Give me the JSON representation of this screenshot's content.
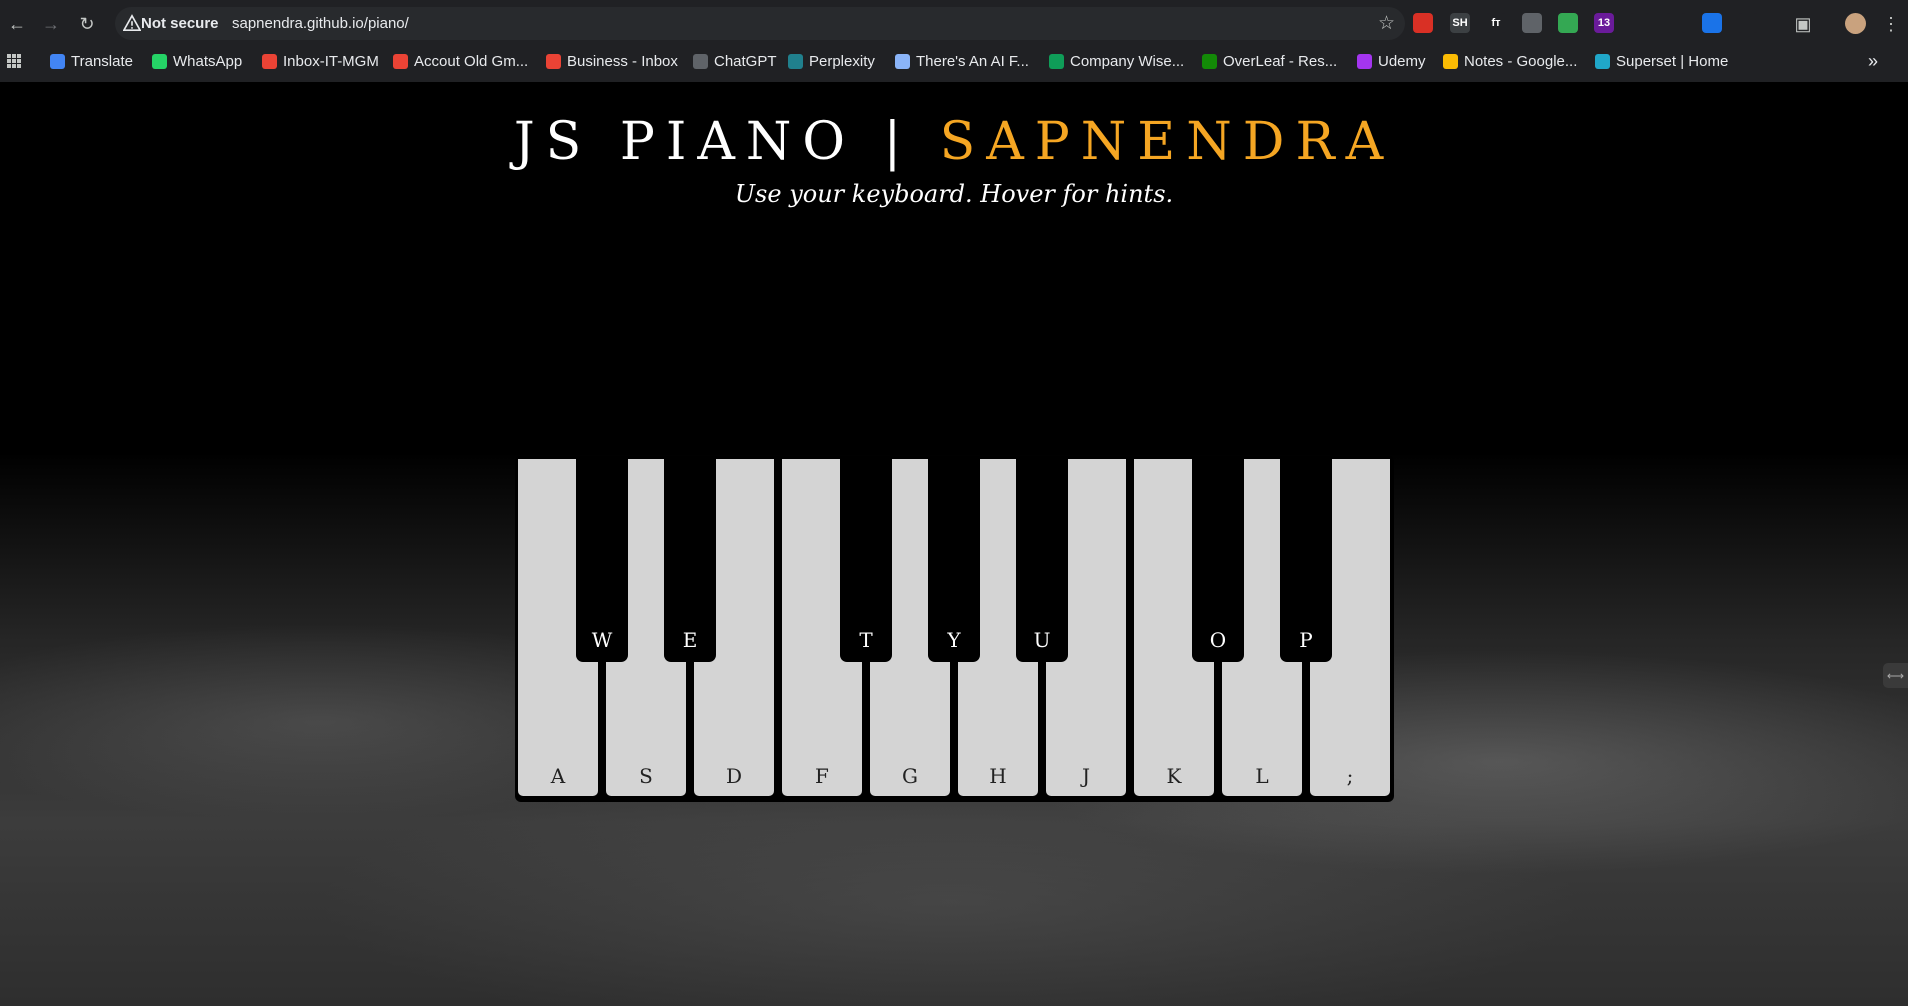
{
  "browser": {
    "security_label": "Not secure",
    "url": "sapnendra.github.io/piano/",
    "extensions": [
      {
        "icon": "pdf-icon",
        "color": "#d93025",
        "text": ""
      },
      {
        "icon": "sh-icon",
        "color": "#3c4043",
        "text": "SH"
      },
      {
        "icon": "function-icon",
        "color": "#202124",
        "text": "fт"
      },
      {
        "icon": "camera-icon",
        "color": "#5f6368",
        "text": ""
      },
      {
        "icon": "shield-icon",
        "color": "#34a853",
        "text": ""
      },
      {
        "icon": "badge-icon",
        "color": "#6a1b9a",
        "text": "13"
      },
      {
        "icon": "eyedropper-icon",
        "color": "#202124",
        "text": ""
      },
      {
        "icon": "atom-icon",
        "color": "#202124",
        "text": ""
      },
      {
        "icon": "bot-icon",
        "color": "#1a73e8",
        "text": ""
      },
      {
        "icon": "puzzle-icon",
        "color": "#202124",
        "text": ""
      }
    ],
    "bookmarks": [
      {
        "label": "Translate",
        "icon": "translate-icon",
        "color": "#4285f4"
      },
      {
        "label": "WhatsApp",
        "icon": "whatsapp-icon",
        "color": "#25d366"
      },
      {
        "label": "Inbox-IT-MGM",
        "icon": "gmail-icon",
        "color": "#ea4335"
      },
      {
        "label": "Accout Old Gm...",
        "icon": "gmail-icon",
        "color": "#ea4335"
      },
      {
        "label": "Business - Inbox",
        "icon": "gmail-icon",
        "color": "#ea4335"
      },
      {
        "label": "ChatGPT",
        "icon": "chatgpt-icon",
        "color": "#5f6368"
      },
      {
        "label": "Perplexity",
        "icon": "perplexity-icon",
        "color": "#20808d"
      },
      {
        "label": "There's An AI F...",
        "icon": "ai-icon",
        "color": "#8ab4f8"
      },
      {
        "label": "Company Wise...",
        "icon": "sheets-icon",
        "color": "#0f9d58"
      },
      {
        "label": "OverLeaf - Res...",
        "icon": "overleaf-icon",
        "color": "#138a07"
      },
      {
        "label": "Udemy",
        "icon": "udemy-icon",
        "color": "#a435f0"
      },
      {
        "label": "Notes - Google...",
        "icon": "drive-icon",
        "color": "#fbbc04"
      },
      {
        "label": "Superset | Home",
        "icon": "superset-icon",
        "color": "#20a7c9"
      }
    ]
  },
  "page": {
    "title_main": "JS PIANO | ",
    "title_accent": "SAPNENDRA",
    "subtitle": "Use your keyboard. Hover for hints.",
    "accent_color": "#f5a623",
    "white_keys": [
      "A",
      "S",
      "D",
      "F",
      "G",
      "H",
      "J",
      "K",
      "L",
      ";"
    ],
    "black_keys": [
      "W",
      "E",
      "T",
      "Y",
      "U",
      "O",
      "P"
    ]
  }
}
